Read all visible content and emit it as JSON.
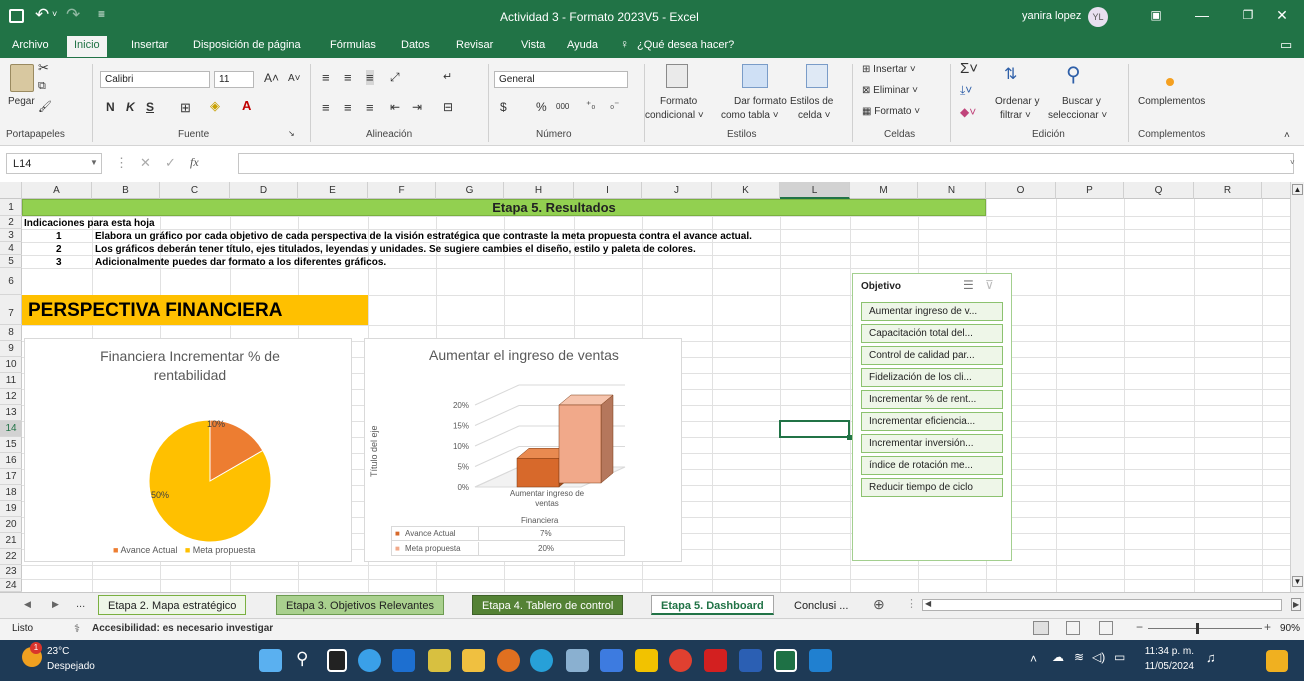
{
  "window": {
    "title": "Actividad 3 - Formato 2023V5  -  Excel",
    "user": "yanira lopez",
    "user_initials": "YL"
  },
  "menu": {
    "items": [
      "Archivo",
      "Inicio",
      "Insertar",
      "Disposición de página",
      "Fórmulas",
      "Datos",
      "Revisar",
      "Vista",
      "Ayuda"
    ],
    "search": "¿Qué desea hacer?"
  },
  "ribbon": {
    "paste": "Pegar",
    "font_name": "Calibri",
    "font_size": "11",
    "bold": "N",
    "italic": "K",
    "underline": "S",
    "number_format": "General",
    "currency": "$",
    "percent": "%",
    "thousands": "000",
    "cond_format": [
      "Formato",
      "condicional ˅"
    ],
    "format_table": [
      "Dar formato",
      "como tabla ˅"
    ],
    "cell_styles": [
      "Estilos de",
      "celda ˅"
    ],
    "insert": "Insertar ˅",
    "delete": "Eliminar ˅",
    "format": "Formato ˅",
    "sort": [
      "Ordenar y",
      "filtrar ˅"
    ],
    "find": [
      "Buscar y",
      "seleccionar ˅"
    ],
    "addins": "Complementos",
    "groups": [
      "Portapapeles",
      "Fuente",
      "Alineación",
      "Número",
      "Estilos",
      "Celdas",
      "Edición",
      "Complementos"
    ]
  },
  "formula_bar": {
    "name_box": "L14",
    "fx": "fx",
    "content": ""
  },
  "columns": [
    "A",
    "B",
    "C",
    "D",
    "E",
    "F",
    "G",
    "H",
    "I",
    "J",
    "K",
    "L",
    "M",
    "N",
    "O",
    "P",
    "Q",
    "R"
  ],
  "rows": [
    "1",
    "2",
    "3",
    "4",
    "5",
    "6",
    "7",
    "8",
    "9",
    "10",
    "11",
    "12",
    "13",
    "14",
    "15",
    "16",
    "17",
    "18",
    "19",
    "20",
    "21",
    "22",
    "23",
    "24"
  ],
  "sheet": {
    "title": "Etapa 5. Resultados",
    "indications_header": "Indicaciones para esta hoja",
    "items": [
      {
        "num": "1",
        "text": "Elabora un gráfico por cada objetivo de cada perspectiva de la visión estratégica que contraste la meta propuesta contra el avance actual."
      },
      {
        "num": "2",
        "text": "Los gráficos deberán tener título, ejes titulados, leyendas y unidades. Se sugiere cambies el diseño, estilo y paleta de colores."
      },
      {
        "num": "3",
        "text": "Adicionalmente puedes dar formato a los diferentes gráficos."
      }
    ],
    "perspective": "PERSPECTIVA FINANCIERA"
  },
  "chart_data": [
    {
      "type": "pie",
      "title": "Financiera Incrementar % de rentabilidad",
      "categories": [
        "Avance Actual",
        "Meta propuesta"
      ],
      "values": [
        10,
        50
      ],
      "data_labels": [
        "10%",
        "50%"
      ],
      "legend": "bottom",
      "colors": [
        "#ed7d31",
        "#ffc000"
      ]
    },
    {
      "type": "bar",
      "title": "Aumentar el ingreso de ventas",
      "categories": [
        "Aumentar ingreso de ventas"
      ],
      "category_group": "Financiera",
      "ylabel": "Título del eje",
      "ylim": [
        0,
        20
      ],
      "yticks": [
        "0%",
        "5%",
        "10%",
        "15%",
        "20%"
      ],
      "series": [
        {
          "name": "Avance Actual",
          "values": [
            7
          ],
          "label": "7%",
          "color": "#d7692b"
        },
        {
          "name": "Meta propuesta",
          "values": [
            20
          ],
          "label": "20%",
          "color": "#f1a98a"
        }
      ],
      "legend": "data table"
    }
  ],
  "slicer": {
    "title": "Objetivo",
    "items": [
      "Aumentar ingreso de v...",
      "Capacitación total del...",
      "Control de calidad par...",
      "Fidelización de los cli...",
      "Incrementar % de rent...",
      "Incrementar eficiencia...",
      "Incrementar inversión...",
      "índice de rotación me...",
      "Reducir tiempo de ciclo"
    ]
  },
  "tabs": {
    "ellipsis": "...",
    "items": [
      "Etapa 2. Mapa estratégico",
      "Etapa 3. Objetivos Relevantes",
      "Etapa 4. Tablero de control",
      "Etapa 5. Dashboard",
      "Conclusi ..."
    ],
    "active": "Etapa 5. Dashboard"
  },
  "status": {
    "ready": "Listo",
    "accessibility": "Accesibilidad: es necesario investigar",
    "zoom": "90%"
  },
  "taskbar": {
    "temp": "23°C",
    "weather": "Despejado",
    "time": "11:34 p. m.",
    "date": "11/05/2024",
    "badge": "1"
  },
  "colors": {
    "excel_green": "#217346",
    "header_green": "#92d050",
    "perspective_orange": "#ffc000",
    "taskbar": "#1e3a56"
  }
}
